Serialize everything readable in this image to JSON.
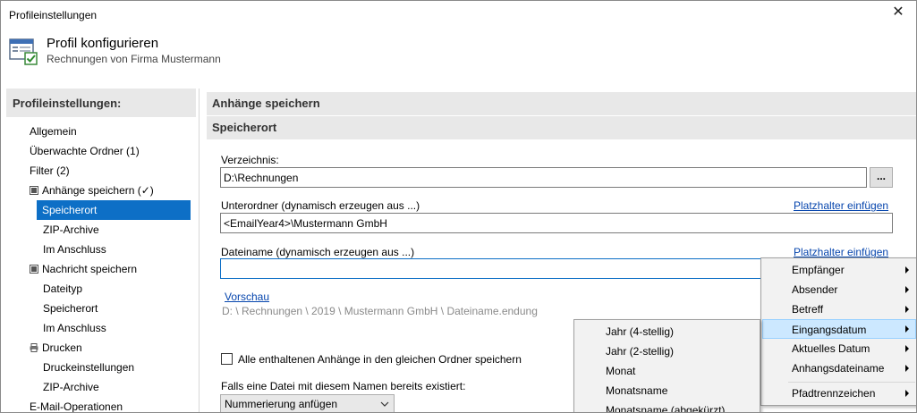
{
  "window": {
    "title": "Profileinstellungen",
    "close_glyph": "✕"
  },
  "header": {
    "title": "Profil konfigurieren",
    "subtitle": "Rechnungen von Firma Mustermann",
    "icon": "settings-window-check-icon"
  },
  "sidebar": {
    "heading": "Profileinstellungen:",
    "items": [
      {
        "label": "Allgemein"
      },
      {
        "label": "Überwachte Ordner (1)"
      },
      {
        "label": "Filter (2)"
      },
      {
        "label": "Anhänge speichern (✓)"
      },
      {
        "label": "Speicherort"
      },
      {
        "label": "ZIP-Archive"
      },
      {
        "label": "Im Anschluss"
      },
      {
        "label": "Nachricht speichern"
      },
      {
        "label": "Dateityp"
      },
      {
        "label": "Speicherort"
      },
      {
        "label": "Im Anschluss"
      },
      {
        "label": "Drucken"
      },
      {
        "label": "Druckeinstellungen"
      },
      {
        "label": "ZIP-Archive"
      },
      {
        "label": "E-Mail-Operationen"
      }
    ],
    "selected_color": "#0d6fc6"
  },
  "content": {
    "section1": "Anhänge speichern",
    "section2": "Speicherort",
    "directory_label": "Verzeichnis:",
    "directory_value": "D:\\Rechnungen",
    "browse_label": "...",
    "subfolder_label": "Unterordner (dynamisch erzeugen aus ...)",
    "subfolder_link": "Platzhalter einfügen",
    "subfolder_value": "<EmailYear4>\\Mustermann GmbH",
    "filename_label": "Dateiname (dynamisch erzeugen aus ...)",
    "filename_link": "Platzhalter einfügen",
    "filename_value": "",
    "preview_link": "Vorschau",
    "preview_path": "D: \\ Rechnungen \\ 2019 \\ Mustermann GmbH \\ Dateiname.endung",
    "same_folder_checkbox": "Alle enthaltenen Anhänge in den gleichen Ordner speichern",
    "same_folder_checked": false,
    "exists_label": "Falls eine Datei mit diesem Namen bereits existiert:",
    "exists_select": "Nummerierung anfügen"
  },
  "placeholder_menu": {
    "items": [
      {
        "label": "Empfänger",
        "submenu": true
      },
      {
        "label": "Absender",
        "submenu": true
      },
      {
        "label": "Betreff",
        "submenu": true
      },
      {
        "label": "Eingangsdatum",
        "submenu": true,
        "highlighted": true
      },
      {
        "label": "Aktuelles Datum",
        "submenu": true
      },
      {
        "label": "Anhangsdateiname",
        "submenu": true
      },
      {
        "label": "Pfadtrennzeichen",
        "submenu": true
      }
    ]
  },
  "date_submenu": {
    "items": [
      {
        "label": "Jahr (4-stellig)"
      },
      {
        "label": "Jahr (2-stellig)"
      },
      {
        "label": "Monat"
      },
      {
        "label": "Monatsname"
      },
      {
        "label": "Monatsname (abgekürzt)"
      }
    ]
  }
}
